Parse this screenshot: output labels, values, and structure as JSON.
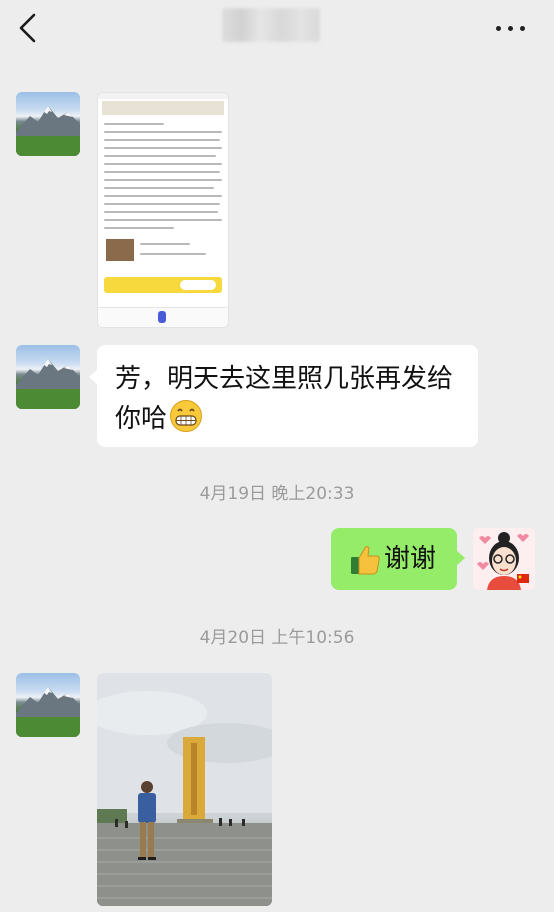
{
  "header": {
    "back_icon": "chevron-left-icon",
    "more_icon": "more-dots-icon"
  },
  "messages": [
    {
      "type": "image",
      "from": "contact",
      "image": "shared-article-screenshot"
    },
    {
      "type": "text",
      "from": "contact",
      "text": "芳，明天去这里照几张再发给你哈",
      "emoji": "grin-emoji"
    },
    {
      "type": "time",
      "text": "4月19日 晚上20:33"
    },
    {
      "type": "text",
      "from": "me",
      "text": "谢谢",
      "emoji": "thumbs-up-emoji"
    },
    {
      "type": "time",
      "text": "4月20日 上午10:56"
    },
    {
      "type": "image",
      "from": "contact",
      "image": "monument-photo"
    }
  ],
  "colors": {
    "background": "#ededed",
    "incoming_bubble": "#ffffff",
    "outgoing_bubble": "#95ec69",
    "timestamp": "#9b9b9b"
  }
}
